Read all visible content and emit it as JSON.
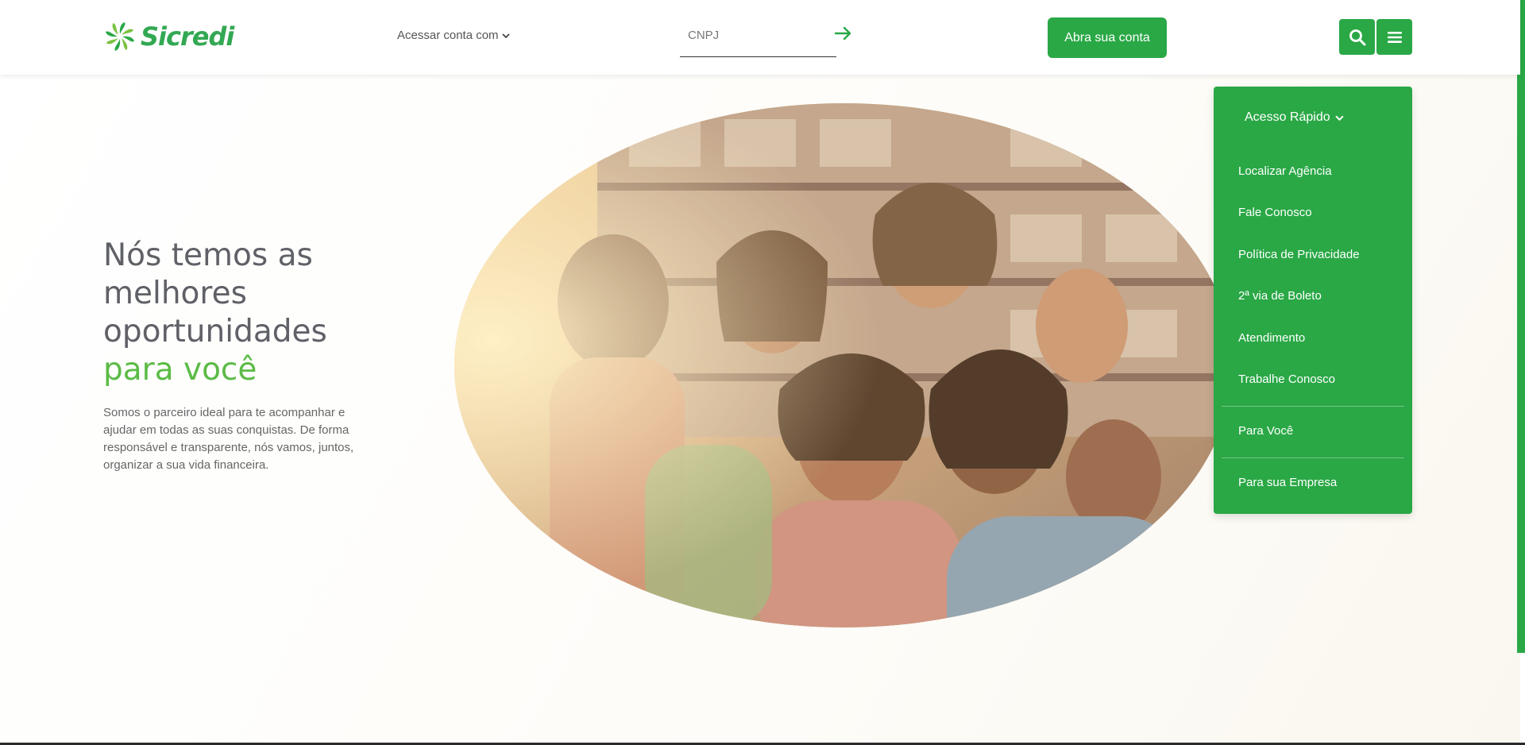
{
  "brand": {
    "name": "Sicredi",
    "color": "#33a853"
  },
  "header": {
    "account_select_label": "Acessar conta com",
    "cnpj_placeholder": "CNPJ",
    "open_account_label": "Abra sua conta",
    "icons": {
      "go": "arrow-right-icon",
      "search": "search-icon",
      "menu": "hamburger-menu-icon"
    }
  },
  "hero": {
    "title_lines": [
      "Nós temos as",
      "melhores",
      "oportunidades"
    ],
    "title_accent": "para você",
    "description": "Somos o parceiro ideal para te acompanhar e ajudar em todas as suas conquistas. De forma responsável e transparente, nós vamos, juntos, organizar a sua vida financeira."
  },
  "dropdown": {
    "header_label": "Acesso Rápido",
    "items": [
      {
        "label": "Localizar Agência"
      },
      {
        "label": "Fale Conosco"
      },
      {
        "label": "Política de Privacidade"
      },
      {
        "label": "2ª via de Boleto"
      },
      {
        "label": "Atendimento"
      },
      {
        "label": "Trabalhe Conosco"
      }
    ],
    "sections": [
      {
        "label": "Para Você"
      },
      {
        "label": "Para sua Empresa"
      }
    ]
  },
  "colors": {
    "accent": "#2aa846",
    "accent_text": "#5bbb46",
    "title_gray": "#5f6167"
  }
}
